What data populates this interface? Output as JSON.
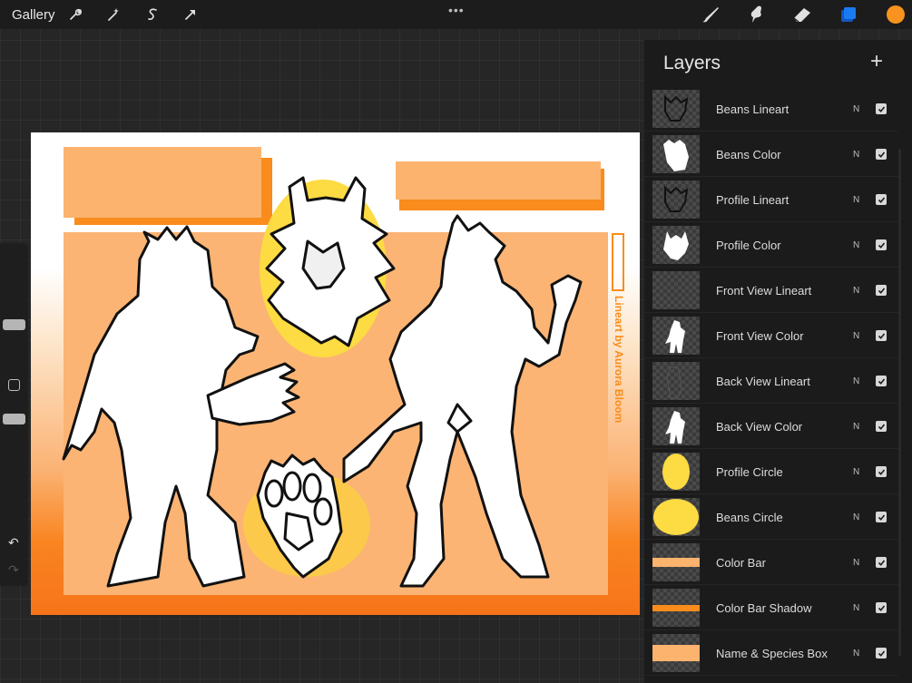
{
  "toolbar": {
    "gallery_label": "Gallery",
    "more_label": "•••",
    "tools": [
      "wrench-icon",
      "magic-wand-icon",
      "selection-icon",
      "transform-arrow-icon"
    ],
    "right_tools": [
      "brush-icon",
      "smudge-icon",
      "eraser-icon",
      "layers-icon"
    ],
    "current_color": "#f7931e",
    "layers_active_color": "#1a6fe8"
  },
  "sidebar": {
    "undo_label": "↶",
    "redo_label": "↷"
  },
  "canvas": {
    "credit_text": "Lineart by Aurora Bloom",
    "colors": {
      "bar": "#fbb36e",
      "bar_shadow": "#f98c1c",
      "circle": "#fddb42",
      "panel": "#fbb474",
      "gradient_bottom": "#f7741a"
    }
  },
  "layers": {
    "title": "Layers",
    "add_label": "+",
    "items": [
      {
        "name": "Beans Lineart",
        "blend": "N",
        "visible": true,
        "thumb": "lineart"
      },
      {
        "name": "Beans Color",
        "blend": "N",
        "visible": true,
        "thumb": "white-paw"
      },
      {
        "name": "Profile Lineart",
        "blend": "N",
        "visible": true,
        "thumb": "lineart"
      },
      {
        "name": "Profile Color",
        "blend": "N",
        "visible": true,
        "thumb": "white-head"
      },
      {
        "name": "Front View Lineart",
        "blend": "N",
        "visible": true,
        "thumb": "empty"
      },
      {
        "name": "Front View Color",
        "blend": "N",
        "visible": true,
        "thumb": "white-figure"
      },
      {
        "name": "Back View Lineart",
        "blend": "N",
        "visible": true,
        "thumb": "faint"
      },
      {
        "name": "Back View Color",
        "blend": "N",
        "visible": true,
        "thumb": "white-figure"
      },
      {
        "name": "Profile Circle",
        "blend": "N",
        "visible": true,
        "thumb": "yellow-oval"
      },
      {
        "name": "Beans Circle",
        "blend": "N",
        "visible": true,
        "thumb": "yellow-ellipse"
      },
      {
        "name": "Color Bar",
        "blend": "N",
        "visible": true,
        "thumb": "peach-bar"
      },
      {
        "name": "Color Bar Shadow",
        "blend": "N",
        "visible": true,
        "thumb": "orange-bar"
      },
      {
        "name": "Name & Species Box",
        "blend": "N",
        "visible": true,
        "thumb": "peach-box"
      }
    ]
  }
}
